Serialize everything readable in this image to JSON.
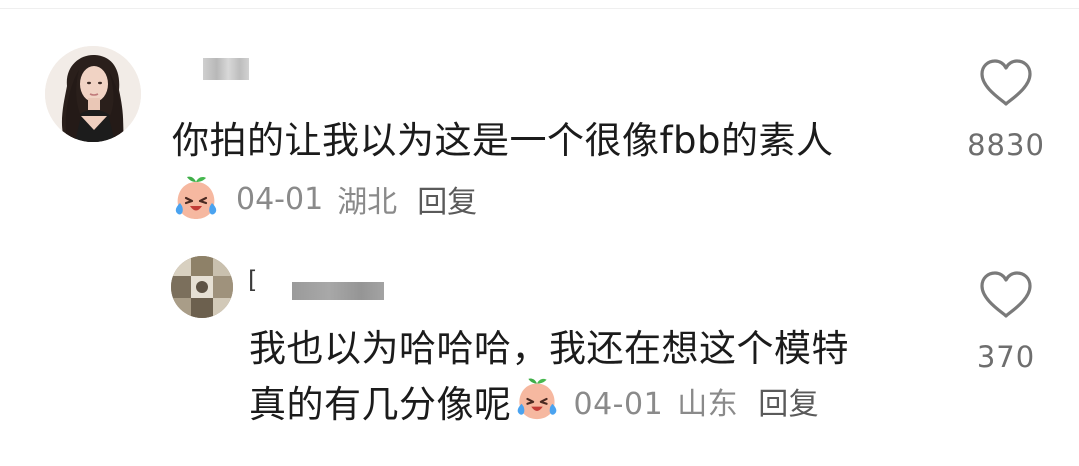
{
  "comments": {
    "main": {
      "text": "你拍的让我以为这是一个很像fbb的素人",
      "date": "04-01",
      "location": "湖北",
      "reply_label": "回复",
      "like_count": "8830",
      "avatar": "woman-portrait-avatar",
      "name_icon": "redacted-username",
      "emoji_icon": "crying-laughing-emoji-icon"
    },
    "reply": {
      "text_line1": "我也以为哈哈哈，我还在想这个模特",
      "text_line2": "真的有几分像呢",
      "date": "04-01",
      "location": "山东",
      "reply_label": "回复",
      "like_count": "370",
      "name_mark": "[",
      "avatar": "collage-photo-avatar",
      "emoji_icon": "crying-laughing-emoji-icon"
    }
  },
  "colors": {
    "text_primary": "#1b1b1b",
    "text_meta": "#8a8a8a",
    "like_icon": "#7a7a7a"
  }
}
